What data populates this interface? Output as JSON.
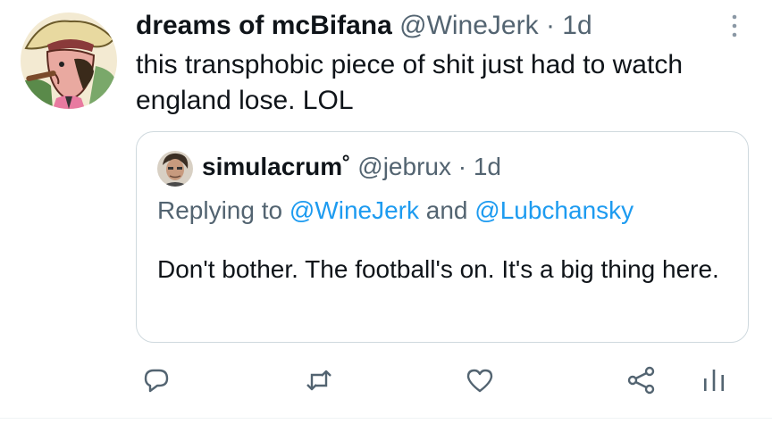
{
  "tweet": {
    "author_name": "dreams of mcBifana",
    "author_handle": "@WineJerk",
    "separator": "·",
    "time": "1d",
    "text": "this transphobic piece of shit just had to watch england lose. LOL"
  },
  "quoted_tweet": {
    "author_name": "simulacrum",
    "name_suffix": "˚",
    "author_handle": "@jebrux",
    "separator": "·",
    "time": "1d",
    "replying_prefix": "Replying to",
    "reply_handle_1": "@WineJerk",
    "reply_and": "and",
    "reply_handle_2": "@Lubchansky",
    "text": "Don't bother. The football's on. It's a big thing here."
  },
  "actions": [
    {
      "name": "reply",
      "icon": "reply-icon"
    },
    {
      "name": "retweet",
      "icon": "retweet-icon"
    },
    {
      "name": "like",
      "icon": "heart-icon"
    },
    {
      "name": "share",
      "icon": "share-icon"
    },
    {
      "name": "analytics",
      "icon": "analytics-icon"
    }
  ],
  "colors": {
    "text": "#0f1419",
    "secondary": "#536471",
    "link": "#1d9bf0",
    "border": "#cfd9de"
  }
}
